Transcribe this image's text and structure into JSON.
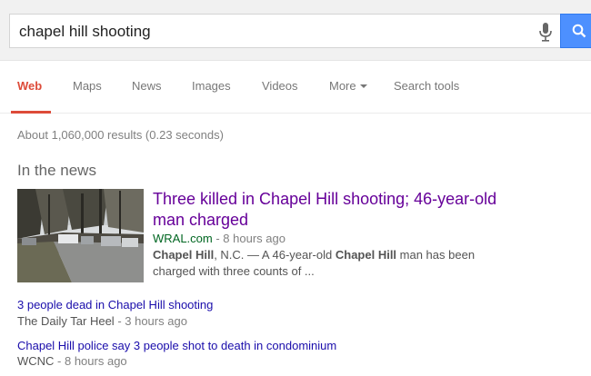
{
  "search": {
    "query": "chapel hill shooting"
  },
  "tabs": [
    {
      "label": "Web",
      "active": true
    },
    {
      "label": "Maps",
      "active": false
    },
    {
      "label": "News",
      "active": false
    },
    {
      "label": "Images",
      "active": false
    },
    {
      "label": "Videos",
      "active": false
    },
    {
      "label": "More",
      "active": false
    },
    {
      "label": "Search tools",
      "active": false
    }
  ],
  "results": {
    "stats": "About 1,060,000 results (0.23 seconds)"
  },
  "news": {
    "heading": "In the news",
    "top_story": {
      "headline": "Three killed in Chapel Hill shooting; 46-year-old man charged",
      "source": "WRAL.com",
      "time": " - 8 hours ago",
      "snippet_parts": [
        {
          "text": "Chapel Hill",
          "bold": true
        },
        {
          "text": ", N.C. — A 46-year-old ",
          "bold": false
        },
        {
          "text": "Chapel Hill",
          "bold": true
        },
        {
          "text": " man has been charged with three counts of ...",
          "bold": false
        }
      ]
    },
    "related": [
      {
        "title": "3 people dead in Chapel Hill shooting",
        "source": "The Daily Tar Heel",
        "time": " - 3 hours ago"
      },
      {
        "title": "Chapel Hill police say 3 people shot to death in condominium",
        "source": "WCNC",
        "time": " - 8 hours ago"
      }
    ]
  },
  "icons": {
    "mic": "microphone-icon",
    "search": "magnifier-icon",
    "more": "caret-down-icon"
  },
  "colors": {
    "accent_tab": "#dd4b39",
    "search_button": "#4d90fe",
    "visited_link": "#660099",
    "link": "#1a0dab",
    "source_green": "#006621"
  }
}
